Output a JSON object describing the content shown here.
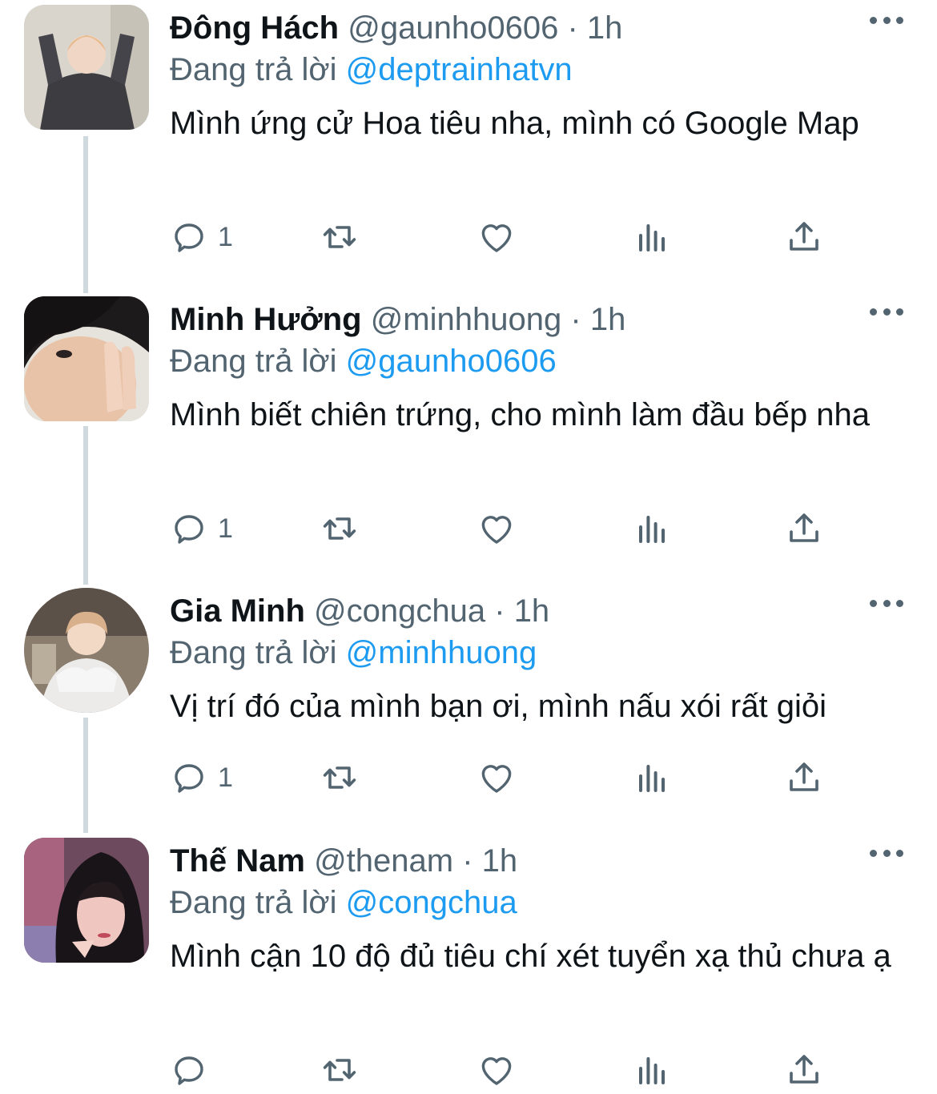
{
  "colors": {
    "accent": "#1d9bf0",
    "text": "#0f1419",
    "secondary": "#536471",
    "thread_line": "#cfd9de"
  },
  "tweets": [
    {
      "name": "Đông Hách",
      "handle": "@gaunho0606",
      "separator": "·",
      "time": "1h",
      "replying_label": "Đang trả lời",
      "replying_to": "@deptrainhatvn",
      "text": "Mình ứng cử Hoa tiêu nha, mình có Google Map",
      "reply_count": "1"
    },
    {
      "name": "Minh Hưởng",
      "handle": "@minhhuong",
      "separator": "·",
      "time": "1h",
      "replying_label": "Đang trả lời",
      "replying_to": "@gaunho0606",
      "text": "Mình biết chiên trứng, cho mình làm đầu bếp nha",
      "reply_count": "1"
    },
    {
      "name": "Gia Minh",
      "handle": "@congchua",
      "separator": "·",
      "time": "1h",
      "replying_label": "Đang trả lời",
      "replying_to": "@minhhuong",
      "text": "Vị trí đó của mình bạn ơi, mình nấu xói rất giỏi",
      "reply_count": "1"
    },
    {
      "name": "Thế Nam",
      "handle": "@thenam",
      "separator": "·",
      "time": "1h",
      "replying_label": "Đang trả lời",
      "replying_to": "@congchua",
      "text": "Mình cận 10 độ đủ tiêu chí xét tuyển xạ thủ chưa ạ",
      "reply_count": ""
    }
  ],
  "icons": {
    "reply": "reply-icon",
    "retweet": "retweet-icon",
    "like": "heart-icon",
    "views": "views-icon",
    "share": "share-icon",
    "more": "more-icon"
  }
}
